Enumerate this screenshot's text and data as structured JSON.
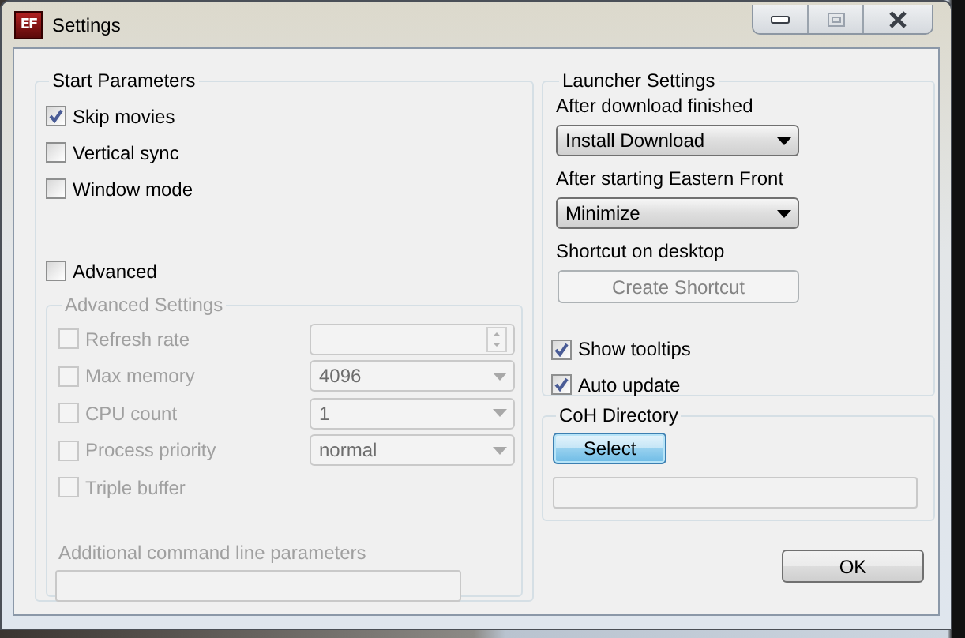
{
  "window": {
    "logo": "EF",
    "title": "Settings"
  },
  "start_parameters": {
    "title": "Start Parameters",
    "options": [
      {
        "label": "Skip movies",
        "checked": true
      },
      {
        "label": "Vertical sync",
        "checked": false
      },
      {
        "label": "Window mode",
        "checked": false
      }
    ],
    "advanced": {
      "label": "Advanced",
      "checked": false
    },
    "advanced_settings": {
      "title": "Advanced Settings",
      "disabled": true,
      "rows": [
        {
          "kind": "spin",
          "label": "Refresh rate",
          "checked": false
        },
        {
          "kind": "dropdown",
          "label": "Max memory",
          "checked": false,
          "value": "4096"
        },
        {
          "kind": "dropdown",
          "label": "CPU count",
          "checked": false,
          "value": "1"
        },
        {
          "kind": "dropdown",
          "label": "Process priority",
          "checked": false,
          "value": "normal"
        },
        {
          "kind": "check",
          "label": "Triple buffer",
          "checked": false
        }
      ],
      "command_line": {
        "label": "Additional command line parameters"
      }
    }
  },
  "launcher_settings": {
    "title": "Launcher Settings",
    "after_download": {
      "label": "After download finished",
      "value": "Install Download"
    },
    "after_start": {
      "label": "After starting Eastern Front",
      "value": "Minimize"
    },
    "shortcut": {
      "label": "Shortcut on desktop",
      "button": "Create Shortcut",
      "disabled": true
    },
    "options": [
      {
        "label": "Show tooltips",
        "checked": true
      },
      {
        "label": "Auto update",
        "checked": true
      }
    ]
  },
  "coh_directory": {
    "title": "CoH Directory",
    "button": "Select",
    "focused": true
  },
  "ok_button": "OK"
}
